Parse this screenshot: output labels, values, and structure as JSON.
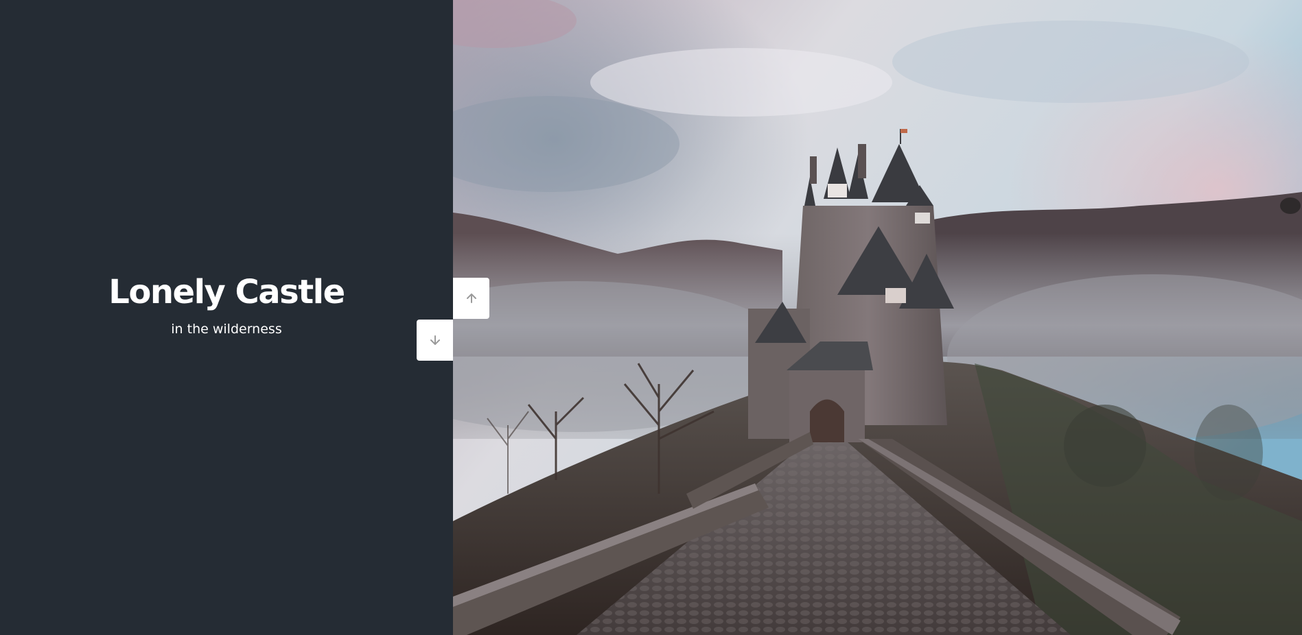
{
  "slide": {
    "title": "Lonely Castle",
    "subtitle": "in the wilderness"
  },
  "navigation": {
    "up_icon": "arrow-up-icon",
    "down_icon": "arrow-down-icon"
  },
  "colors": {
    "panel_background": "#252c34",
    "text": "#ffffff",
    "button_background": "#ffffff",
    "button_icon": "#9a9a9a"
  }
}
